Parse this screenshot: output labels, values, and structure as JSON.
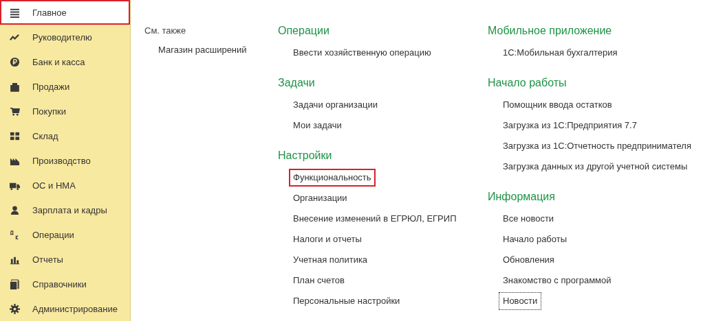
{
  "sidebar": {
    "items": [
      {
        "label": "Главное",
        "selected": true
      },
      {
        "label": "Руководителю",
        "selected": false
      },
      {
        "label": "Банк и касса",
        "selected": false
      },
      {
        "label": "Продажи",
        "selected": false
      },
      {
        "label": "Покупки",
        "selected": false
      },
      {
        "label": "Склад",
        "selected": false
      },
      {
        "label": "Производство",
        "selected": false
      },
      {
        "label": "ОС и НМА",
        "selected": false
      },
      {
        "label": "Зарплата и кадры",
        "selected": false
      },
      {
        "label": "Операции",
        "selected": false
      },
      {
        "label": "Отчеты",
        "selected": false
      },
      {
        "label": "Справочники",
        "selected": false
      },
      {
        "label": "Администрирование",
        "selected": false
      }
    ]
  },
  "columns": [
    {
      "sections": [
        {
          "kind": "see_also",
          "title": "См. также",
          "links": [
            {
              "label": "Магазин расширений",
              "highlighted": false,
              "focused": false
            }
          ]
        }
      ]
    },
    {
      "sections": [
        {
          "kind": "group",
          "title": "Операции",
          "links": [
            {
              "label": "Ввести хозяйственную операцию",
              "highlighted": false,
              "focused": false
            }
          ]
        },
        {
          "kind": "group",
          "title": "Задачи",
          "links": [
            {
              "label": "Задачи организации",
              "highlighted": false,
              "focused": false
            },
            {
              "label": "Мои задачи",
              "highlighted": false,
              "focused": false
            }
          ]
        },
        {
          "kind": "group",
          "title": "Настройки",
          "links": [
            {
              "label": "Функциональность",
              "highlighted": true,
              "focused": false
            },
            {
              "label": "Организации",
              "highlighted": false,
              "focused": false
            },
            {
              "label": "Внесение изменений в ЕГРЮЛ, ЕГРИП",
              "highlighted": false,
              "focused": false
            },
            {
              "label": "Налоги и отчеты",
              "highlighted": false,
              "focused": false
            },
            {
              "label": "Учетная политика",
              "highlighted": false,
              "focused": false
            },
            {
              "label": "План счетов",
              "highlighted": false,
              "focused": false
            },
            {
              "label": "Персональные настройки",
              "highlighted": false,
              "focused": false
            }
          ]
        }
      ]
    },
    {
      "sections": [
        {
          "kind": "group",
          "title": "Мобильное приложение",
          "links": [
            {
              "label": "1С:Мобильная бухгалтерия",
              "highlighted": false,
              "focused": false
            }
          ]
        },
        {
          "kind": "group",
          "title": "Начало работы",
          "links": [
            {
              "label": "Помощник ввода остатков",
              "highlighted": false,
              "focused": false
            },
            {
              "label": "Загрузка из 1С:Предприятия 7.7",
              "highlighted": false,
              "focused": false
            },
            {
              "label": "Загрузка из 1С:Отчетность предпринимателя",
              "highlighted": false,
              "focused": false
            },
            {
              "label": "Загрузка данных из другой учетной системы",
              "highlighted": false,
              "focused": false
            }
          ]
        },
        {
          "kind": "group",
          "title": "Информация",
          "links": [
            {
              "label": "Все новости",
              "highlighted": false,
              "focused": false
            },
            {
              "label": "Начало работы",
              "highlighted": false,
              "focused": false
            },
            {
              "label": "Обновления",
              "highlighted": false,
              "focused": false
            },
            {
              "label": "Знакомство с программой",
              "highlighted": false,
              "focused": false
            },
            {
              "label": "Новости",
              "highlighted": false,
              "focused": true
            }
          ]
        }
      ]
    }
  ]
}
